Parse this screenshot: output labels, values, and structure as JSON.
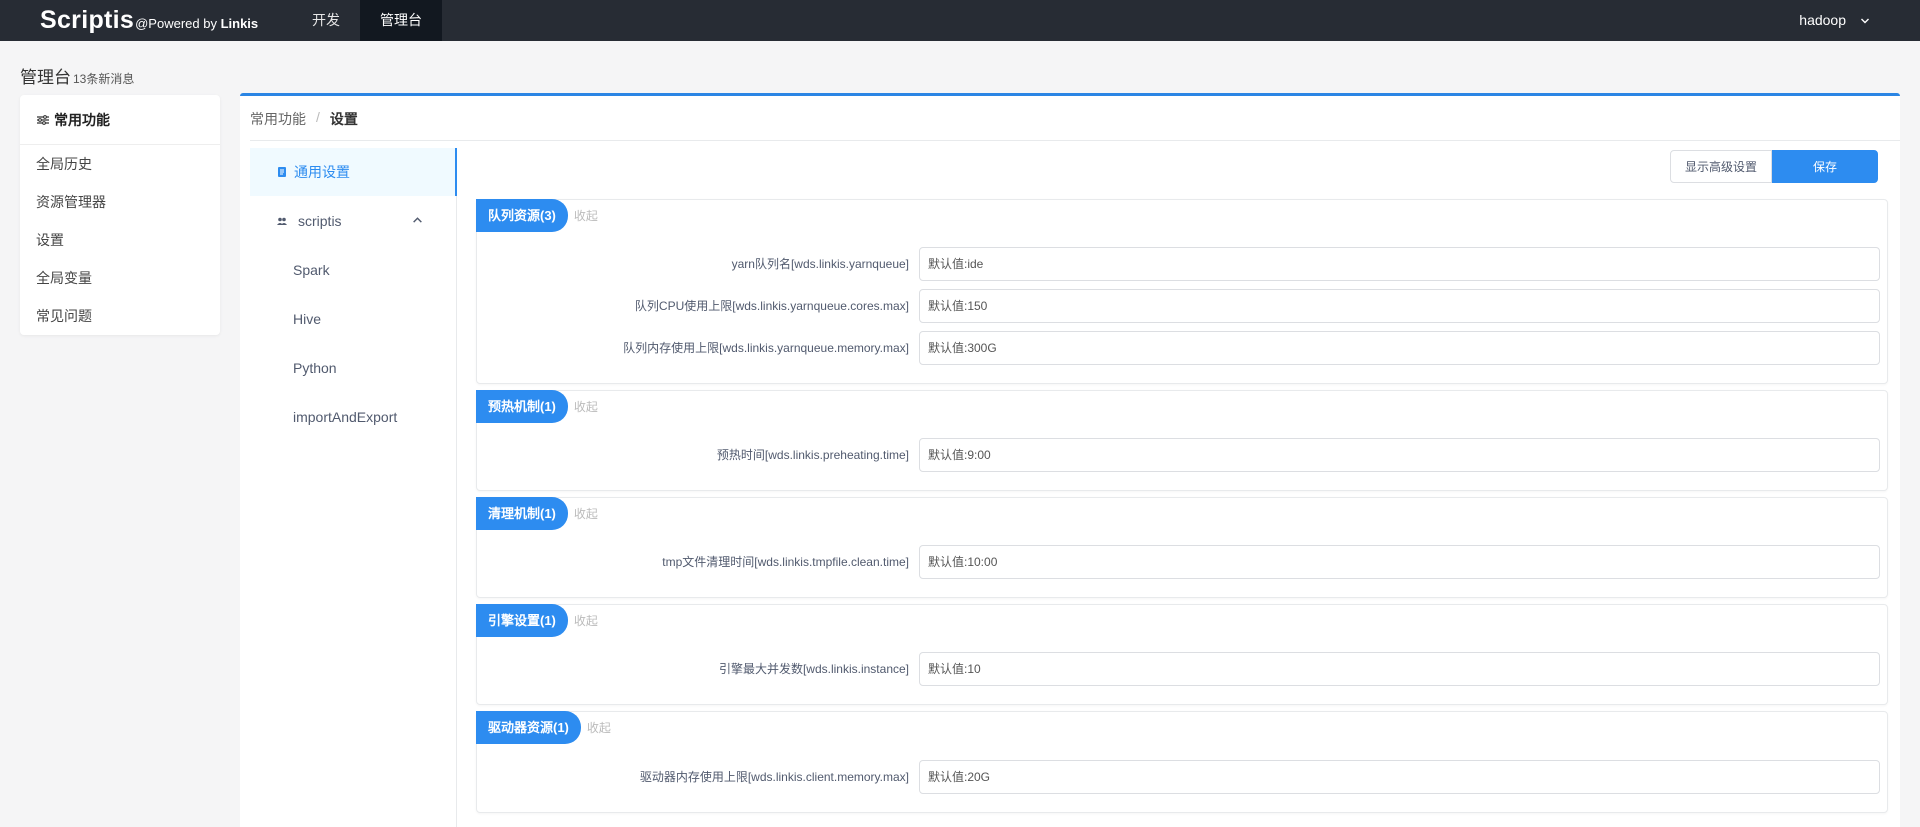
{
  "topbar": {
    "brand": "Scriptis",
    "brand_sub_prefix": "@Powered by ",
    "brand_sub_name": "Linkis",
    "tabs": [
      {
        "label": "开发"
      },
      {
        "label": "管理台"
      }
    ],
    "user": "hadoop"
  },
  "page": {
    "title": "管理台",
    "message_count": "13条新消息"
  },
  "leftmenu": {
    "header": "常用功能",
    "items": [
      {
        "label": "全局历史"
      },
      {
        "label": "资源管理器"
      },
      {
        "label": "设置"
      },
      {
        "label": "全局变量"
      },
      {
        "label": "常见问题"
      }
    ]
  },
  "breadcrumb": {
    "parent": "常用功能",
    "separator": "/",
    "current": "设置"
  },
  "submenu": {
    "active": "通用设置",
    "group": "scriptis",
    "items": [
      {
        "label": "Spark"
      },
      {
        "label": "Hive"
      },
      {
        "label": "Python"
      },
      {
        "label": "importAndExport"
      }
    ]
  },
  "actions": {
    "advanced": "显示高级设置",
    "save": "保存"
  },
  "collapse_label": "收起",
  "sections": [
    {
      "title": "队列资源(3)",
      "fields": [
        {
          "label": "yarn队列名[wds.linkis.yarnqueue]",
          "placeholder": "默认值:ide"
        },
        {
          "label": "队列CPU使用上限[wds.linkis.yarnqueue.cores.max]",
          "placeholder": "默认值:150"
        },
        {
          "label": "队列内存使用上限[wds.linkis.yarnqueue.memory.max]",
          "placeholder": "默认值:300G"
        }
      ]
    },
    {
      "title": "预热机制(1)",
      "fields": [
        {
          "label": "预热时间[wds.linkis.preheating.time]",
          "placeholder": "默认值:9:00"
        }
      ]
    },
    {
      "title": "清理机制(1)",
      "fields": [
        {
          "label": "tmp文件清理时间[wds.linkis.tmpfile.clean.time]",
          "placeholder": "默认值:10:00"
        }
      ]
    },
    {
      "title": "引擎设置(1)",
      "fields": [
        {
          "label": "引擎最大并发数[wds.linkis.instance]",
          "placeholder": "默认值:10"
        }
      ]
    },
    {
      "title": "驱动器资源(1)",
      "fields": [
        {
          "label": "驱动器内存使用上限[wds.linkis.client.memory.max]",
          "placeholder": "默认值:20G"
        }
      ]
    }
  ],
  "colors": {
    "topbar": "#272c34",
    "accent": "#2d8cf0",
    "active_tab": "#121820"
  }
}
